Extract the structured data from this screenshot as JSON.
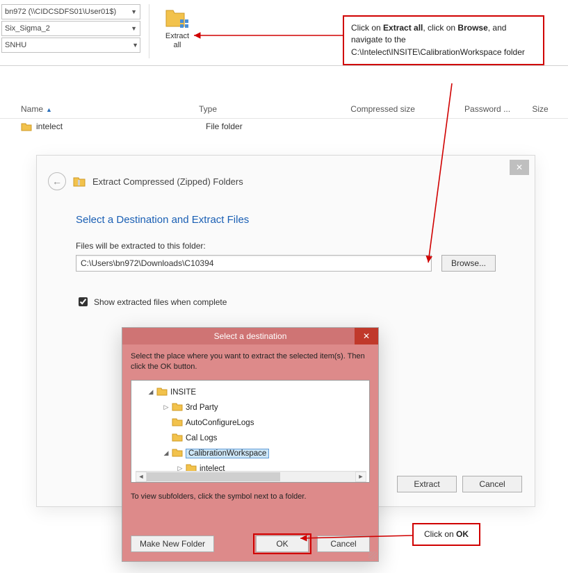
{
  "ribbon": {
    "dropdown1": "bn972 (\\\\CIDCSDFS01\\User01$)",
    "dropdown2": "Six_Sigma_2",
    "dropdown3": "SNHU",
    "extract_label_1": "Extract",
    "extract_label_2": "all"
  },
  "callout1": {
    "t1": "Click on ",
    "b1": "Extract all",
    "t2": ", click on ",
    "b2": "Browse",
    "t3": ", and navigate to the C:\\Intelect\\INSITE\\CalibrationWorkspace folder"
  },
  "columns": {
    "name": "Name",
    "type": "Type",
    "compressed": "Compressed size",
    "password": "Password ...",
    "size": "Size"
  },
  "row": {
    "name": "intelect",
    "type": "File folder"
  },
  "wizard": {
    "title_header": "Extract Compressed (Zipped) Folders",
    "title": "Select a Destination and Extract Files",
    "field_label": "Files will be extracted to this folder:",
    "path": "C:\\Users\\bn972\\Downloads\\C10394",
    "browse": "Browse...",
    "checkbox": "Show extracted files when complete",
    "extract": "Extract",
    "cancel": "Cancel"
  },
  "browse": {
    "title": "Select a destination",
    "desc": "Select the place where you want to extract the selected item(s). Then click the OK button.",
    "tree": {
      "root": "INSITE",
      "n1": "3rd Party",
      "n2": "AutoConfigureLogs",
      "n3": "Cal Logs",
      "n4": "CalibrationWorkspace",
      "n5": "intelect"
    },
    "note": "To view subfolders, click the symbol next to a folder.",
    "make_new": "Make New Folder",
    "ok": "OK",
    "cancel": "Cancel"
  },
  "callout2": {
    "t1": "Click on ",
    "b1": "OK"
  }
}
